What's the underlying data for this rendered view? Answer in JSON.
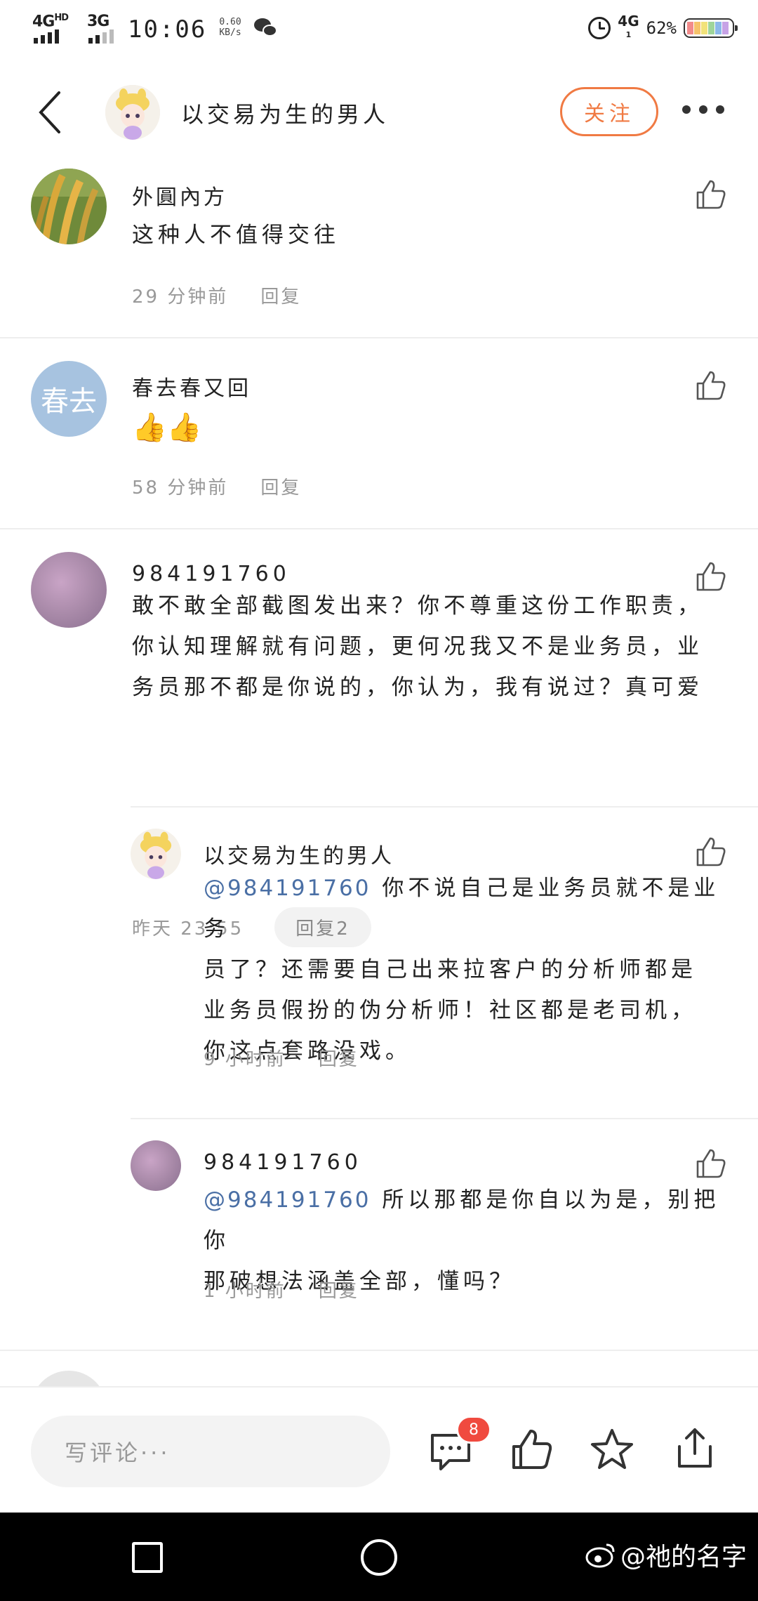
{
  "status_bar": {
    "network1": "4G",
    "network1_sup": "HD",
    "network2": "3G",
    "time": "10:06",
    "speed_value": "0.60",
    "speed_unit": "KB/s",
    "net_right": "4G",
    "net_right_sub": "1",
    "battery_percent": "62%"
  },
  "header": {
    "title": "以交易为生的男人",
    "follow_label": "关注"
  },
  "comments": [
    {
      "user": "外圓內方",
      "text": "这种人不值得交往",
      "time": "29 分钟前",
      "reply_label": "回复"
    },
    {
      "user": "春去春又回",
      "avatar_text": "春去",
      "text": "👍👍",
      "time": "58 分钟前",
      "reply_label": "回复"
    },
    {
      "user": "984191760",
      "text_lines": [
        "敢不敢全部截图发出来？你不尊重这份工作职责，",
        "你认知理解就有问题，更何况我又不是业务员，业",
        "务员那不都是你说的，你认为，我有说过？真可爱"
      ],
      "time": "昨天 23:55",
      "reply_label": "回复2",
      "replies": [
        {
          "user": "以交易为生的男人",
          "mention": "@984191760",
          "text_lines": [
            " 你不说自己是业务员就不是业务",
            "员了？还需要自己出来拉客户的分析师都是",
            "业务员假扮的伪分析师！社区都是老司机，",
            "你这点套路没戏。"
          ],
          "time": "9 小时前",
          "reply_label": "回复"
        },
        {
          "user": "984191760",
          "mention": "@984191760",
          "text_lines": [
            " 所以那都是你自以为是，别把你",
            "那破想法涵盖全部，懂吗？"
          ],
          "time": "1 小时前",
          "reply_label": "回复"
        }
      ]
    }
  ],
  "bottom_bar": {
    "input_placeholder": "写评论···",
    "comment_count_badge": "8"
  },
  "watermark": "@祂的名字",
  "colors": {
    "accent": "#f07a43",
    "mention": "#4a6fa5",
    "badge": "#f04a3f",
    "avatar_blue": "#a7c3e0"
  }
}
